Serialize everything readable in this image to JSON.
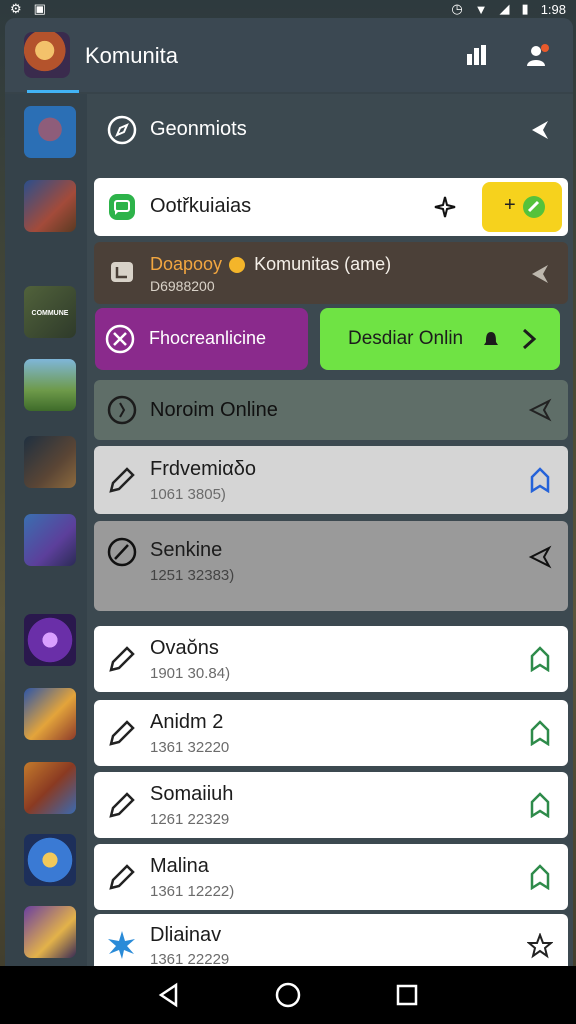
{
  "status_bar": {
    "time": "1:98"
  },
  "header": {
    "title": "Komunita"
  },
  "sidebar": {
    "items": [
      {
        "icon": "game-thumb-1",
        "label": ""
      },
      {
        "icon": "game-thumb-2",
        "label": ""
      },
      {
        "icon": "game-thumb-3",
        "label": "COMMUNE"
      },
      {
        "icon": "game-thumb-4",
        "label": ""
      },
      {
        "icon": "game-thumb-5",
        "label": ""
      },
      {
        "icon": "game-thumb-6",
        "label": ""
      },
      {
        "icon": "game-thumb-7",
        "label": ""
      },
      {
        "icon": "game-thumb-8",
        "label": ""
      },
      {
        "icon": "game-thumb-9",
        "label": ""
      },
      {
        "icon": "game-thumb-10",
        "label": ""
      },
      {
        "icon": "game-thumb-11",
        "label": ""
      }
    ]
  },
  "content": {
    "section_header": "Geonmiots",
    "highlight_row": {
      "title": "Ootřkuiaias",
      "badge": "+"
    },
    "game_row": {
      "title_accent": "Doapooy",
      "title_rest": "Komunitas (ame)",
      "subtitle": "D6988200"
    },
    "purple_button": "Fhocreanlicine",
    "green_button": "Desdiar Onlin",
    "online_row": "Noroim Online",
    "entries": [
      {
        "title": "Frdvemiαδo",
        "subtitle": "1061 3805)"
      },
      {
        "title": "Senkine",
        "subtitle": "1251 32383)"
      },
      {
        "title": "Ovaŏns",
        "subtitle": "1901 30.84)"
      },
      {
        "title": "Anidm 2",
        "subtitle": "1361 32220"
      },
      {
        "title": "Somaiiuh",
        "subtitle": "1261 22329"
      },
      {
        "title": "Malina",
        "subtitle": "1361 12222)"
      },
      {
        "title": "Dliainav",
        "subtitle": "1361 22229"
      }
    ]
  },
  "colors": {
    "accent_blue": "#42b3f5",
    "purple": "#8a2a8c",
    "green": "#6fe344",
    "yellow": "#f6d21d"
  }
}
